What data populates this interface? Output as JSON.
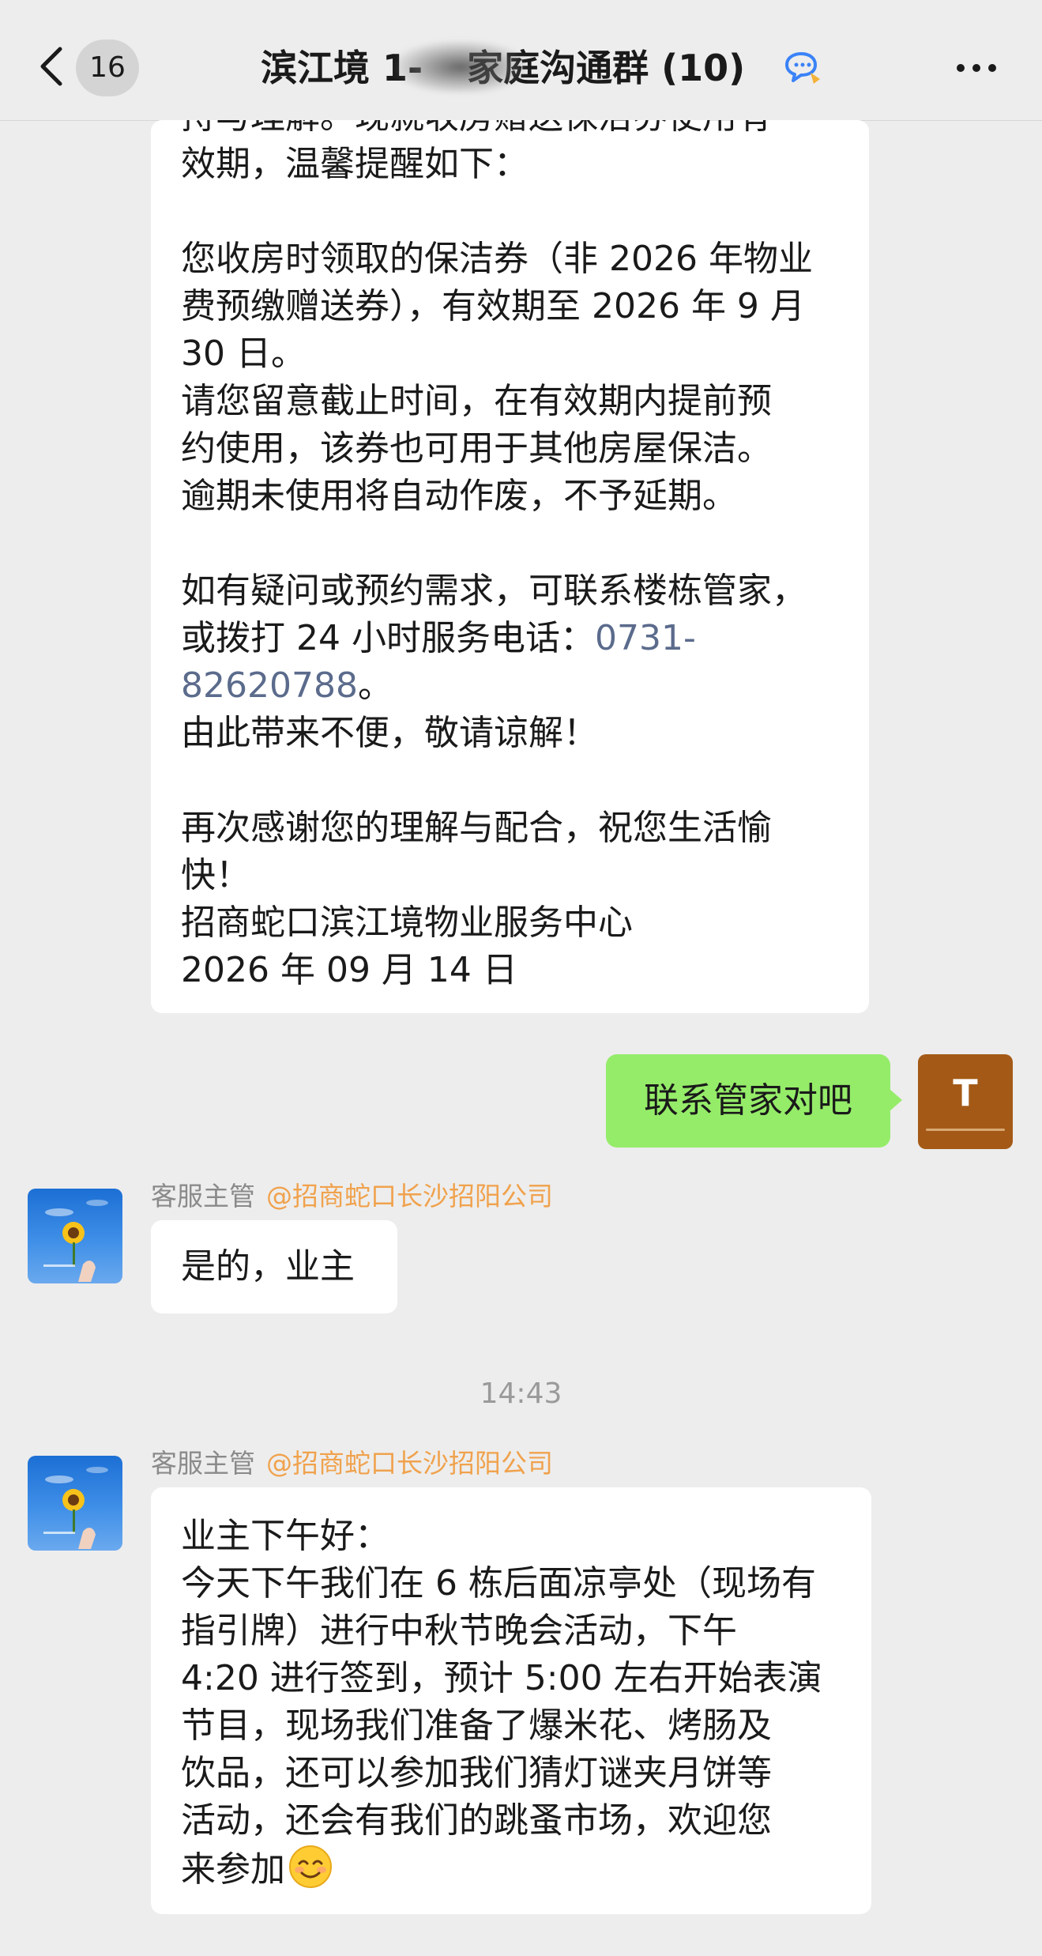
{
  "header": {
    "unread_count": "16",
    "title_prefix": "滨江境 1-",
    "title_suffix": "家庭沟通群 (10)"
  },
  "messages": {
    "notice": {
      "lines_a": [
        "持与理解。现就收房赠送保洁券使用有",
        "效期，温馨提醒如下："
      ],
      "lines_b": [
        "您收房时领取的保洁券（非 2026 年物业",
        "费预缴赠送券），有效期至 2026 年 9 月",
        "30 日。",
        "请您留意截止时间，在有效期内提前预",
        "约使用，该券也可用于其他房屋保洁。",
        "逾期未使用将自动作废，不予延期。"
      ],
      "contact_line1": "如有疑问或预约需求，可联系楼栋管家，",
      "contact_line2_prefix": "或拨打 24 小时服务电话：",
      "phone_part1": "0731-",
      "phone_part2": "82620788",
      "phone_suffix": "。",
      "apology": "由此带来不便，敬请谅解！",
      "lines_c": [
        "再次感谢您的理解与配合，祝您生活愉",
        "快！",
        "招商蛇口滨江境物业服务中心",
        "2026 年 09 月 14 日"
      ]
    },
    "self_reply": "联系管家对吧",
    "self_avatar_letter": "T",
    "reply1": {
      "sender": "客服主管",
      "mention": "@招商蛇口长沙招阳公司",
      "text": "是的，业主"
    },
    "timestamp": "14:43",
    "reply2": {
      "sender": "客服主管",
      "mention": "@招商蛇口长沙招阳公司",
      "lines": [
        "业主下午好：",
        "今天下午我们在 6 栋后面凉亭处（现场有",
        "指引牌）进行中秋节晚会活动，下午",
        "4:20 进行签到，预计 5:00 左右开始表演",
        "节目，现场我们准备了爆米花、烤肠及",
        "饮品，还可以参加我们猜灯谜夹月饼等",
        "活动，还会有我们的跳蚤市场，欢迎您"
      ],
      "last_line": "来参加",
      "emoji": "smiling-face-emoji"
    }
  },
  "colors": {
    "background": "#ededed",
    "self_bubble": "#95ec69",
    "mention": "#f0a24d",
    "link": "#5b6b8c"
  }
}
